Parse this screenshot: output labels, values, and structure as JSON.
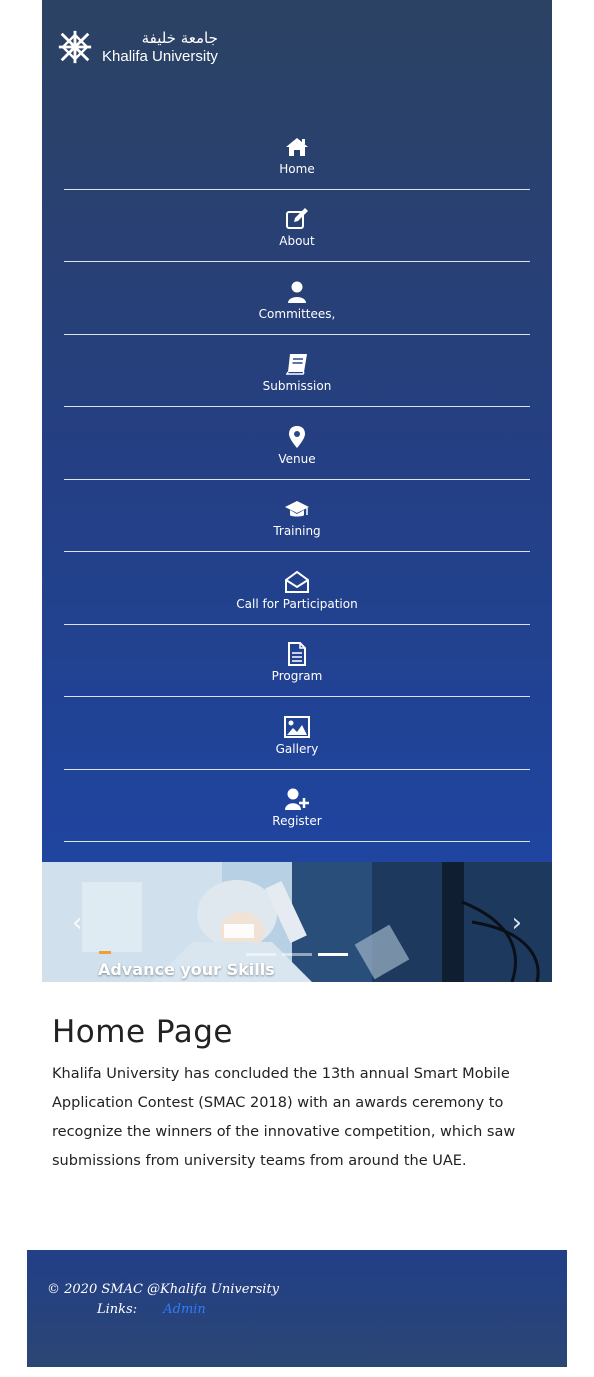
{
  "header": {
    "logo_arabic": "جامعة خليفة",
    "logo_latin": "Khalifa University"
  },
  "nav": {
    "items": [
      {
        "label": "Home",
        "icon": "home-icon"
      },
      {
        "label": "About",
        "icon": "edit-icon"
      },
      {
        "label": "Committees,",
        "icon": "user-icon"
      },
      {
        "label": "Submission",
        "icon": "book-icon"
      },
      {
        "label": "Venue",
        "icon": "map-marker-icon"
      },
      {
        "label": "Training",
        "icon": "graduation-cap-icon"
      },
      {
        "label": "Call for Participation",
        "icon": "envelope-open-icon"
      },
      {
        "label": "Program",
        "icon": "document-icon"
      },
      {
        "label": "Gallery",
        "icon": "image-icon"
      },
      {
        "label": "Register",
        "icon": "user-plus-icon"
      }
    ]
  },
  "carousel": {
    "caption": "Advance your Skills",
    "prev_glyph": "‹",
    "next_glyph": "›",
    "active_index": 2,
    "slide_count": 3
  },
  "main": {
    "title": "Home Page",
    "body": "Khalifa University has concluded the 13th annual Smart Mobile Application Contest (SMAC 2018) with an awards ceremony to recognize the winners of the innovative competition, which saw submissions from university teams from around the UAE."
  },
  "footer": {
    "copyright": "© 2020 SMAC @Khalifa University",
    "links_label": "Links:",
    "admin_link": "Admin"
  },
  "colors": {
    "nav_top": "#2c4263",
    "nav_bottom": "#1f45a0",
    "footer": "#223f88",
    "link": "#2f7cf6",
    "accent": "#f0a032"
  }
}
